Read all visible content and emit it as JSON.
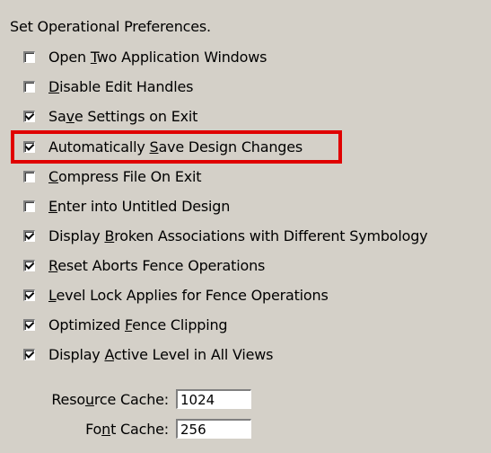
{
  "header": "Set Operational Preferences.",
  "options": [
    {
      "pre": "Open ",
      "u": "T",
      "post": "wo Application Windows",
      "checked": false
    },
    {
      "pre": "",
      "u": "D",
      "post": "isable Edit Handles",
      "checked": false
    },
    {
      "pre": "Sa",
      "u": "v",
      "post": "e Settings on Exit",
      "checked": true
    },
    {
      "pre": "Automatically ",
      "u": "S",
      "post": "ave Design Changes",
      "checked": true
    },
    {
      "pre": "",
      "u": "C",
      "post": "ompress File On Exit",
      "checked": false
    },
    {
      "pre": "",
      "u": "E",
      "post": "nter into Untitled Design",
      "checked": false
    },
    {
      "pre": "Display ",
      "u": "B",
      "post": "roken Associations with Different Symbology",
      "checked": true
    },
    {
      "pre": "",
      "u": "R",
      "post": "eset Aborts Fence Operations",
      "checked": true
    },
    {
      "pre": "",
      "u": "L",
      "post": "evel Lock Applies for Fence Operations",
      "checked": true
    },
    {
      "pre": "Optimized ",
      "u": "F",
      "post": "ence Clipping",
      "checked": true
    },
    {
      "pre": "Display ",
      "u": "A",
      "post": "ctive Level in All Views",
      "checked": true
    }
  ],
  "resource_cache": {
    "pre": "Reso",
    "u": "u",
    "post": "rce Cache:",
    "value": "1024"
  },
  "font_cache": {
    "pre": "Fo",
    "u": "n",
    "post": "t Cache:",
    "value": "256"
  },
  "highlight_color": "#e00000"
}
